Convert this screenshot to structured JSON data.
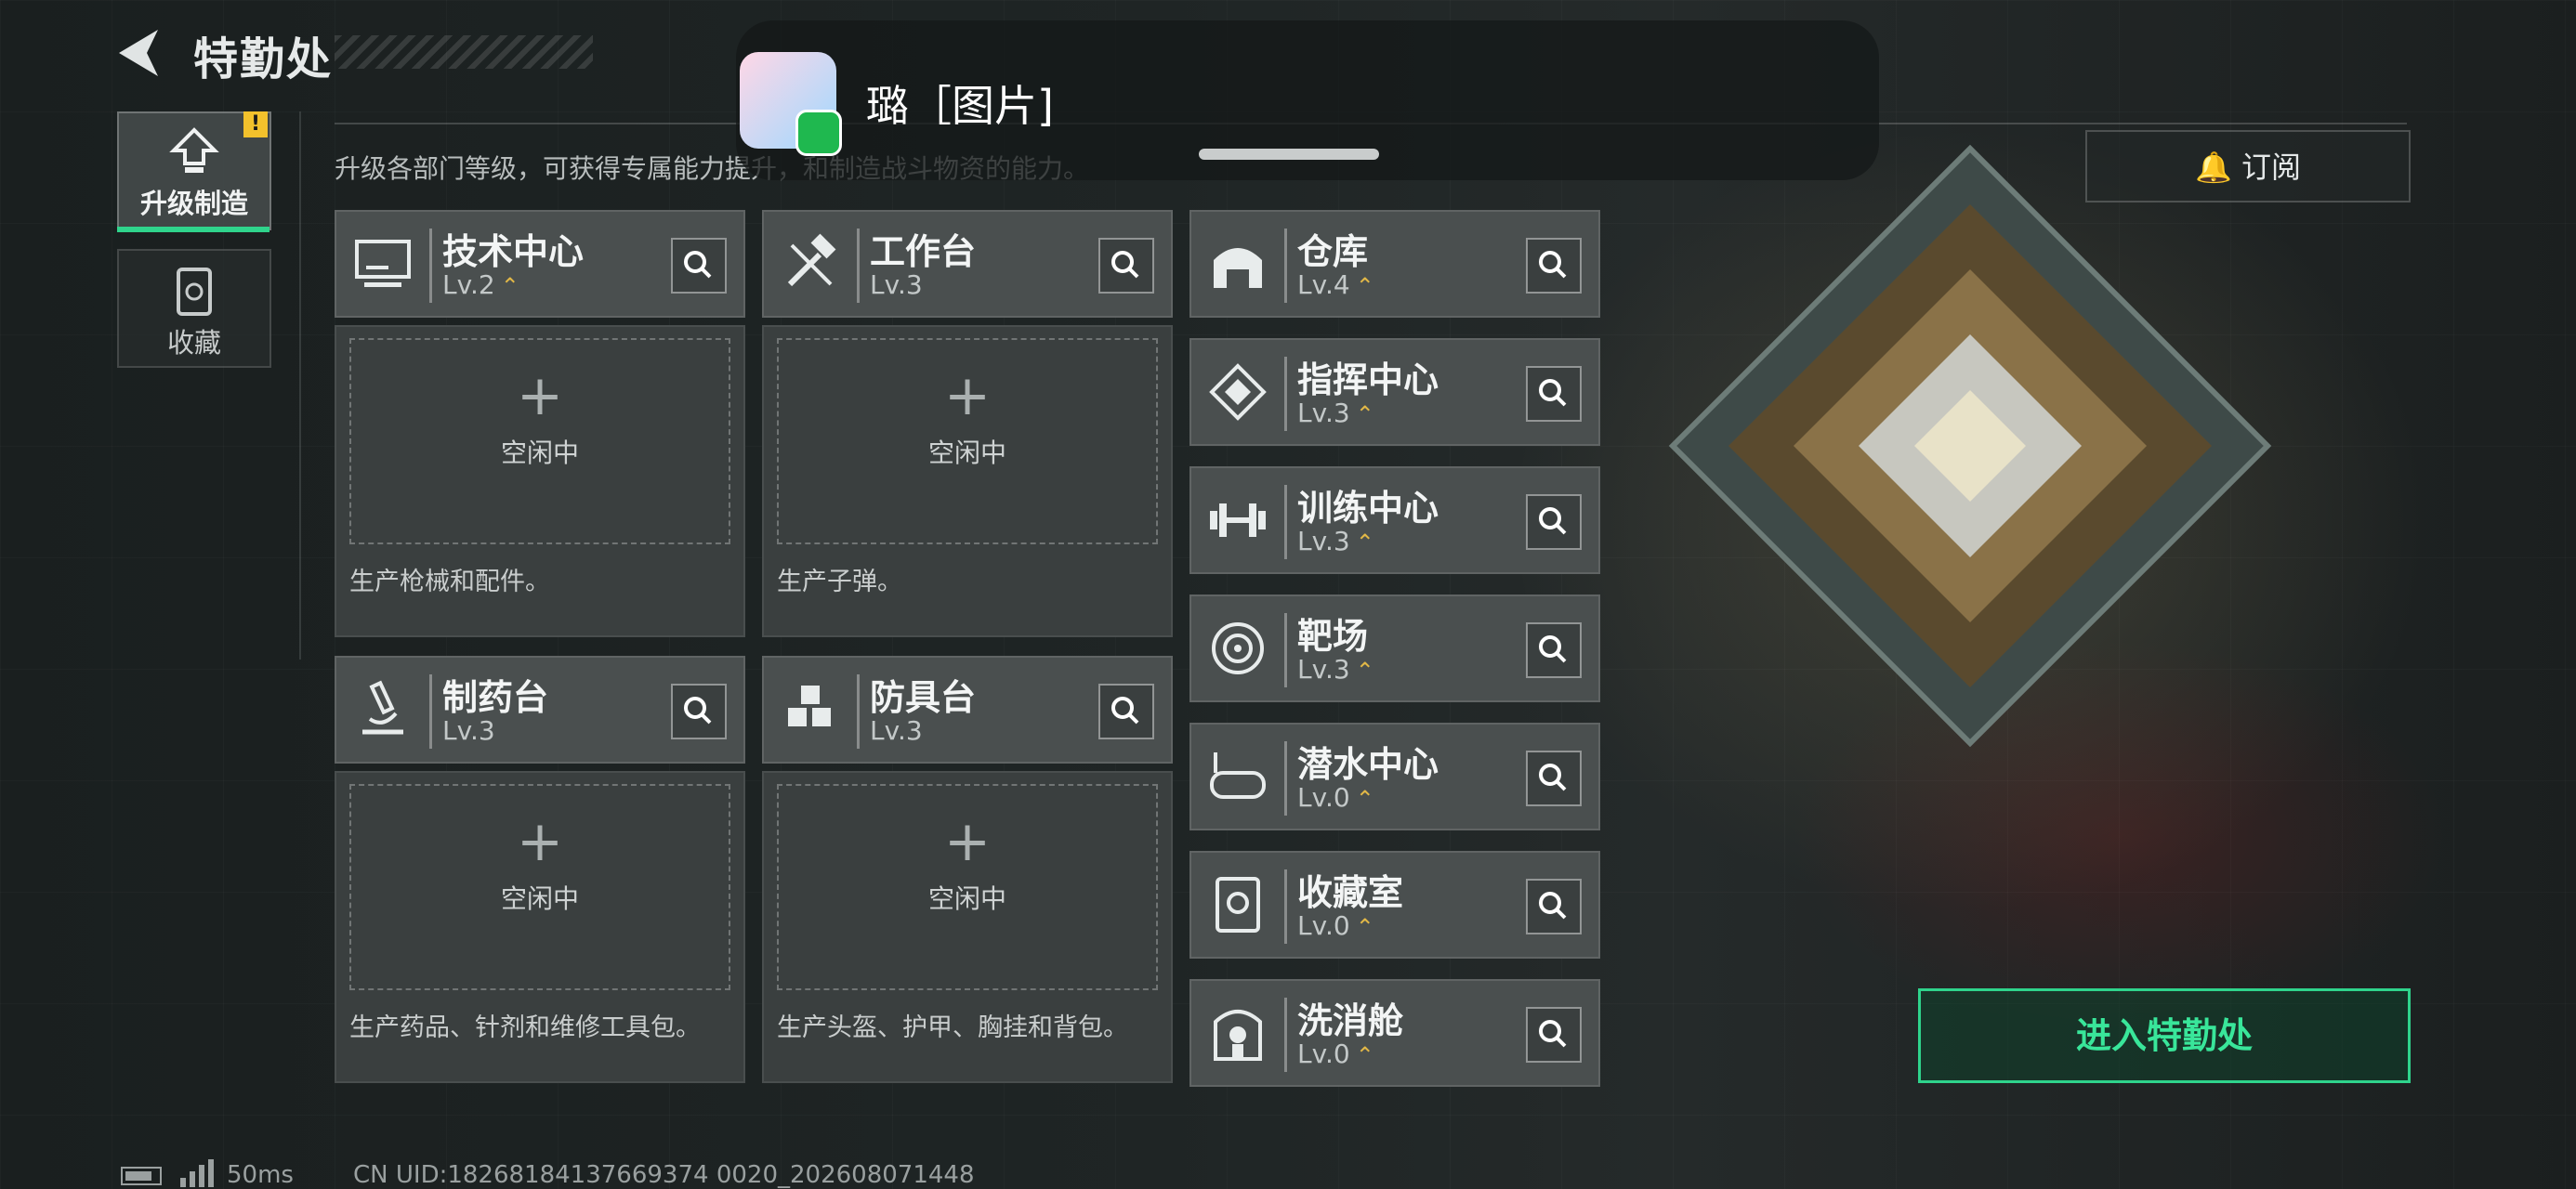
{
  "header": {
    "title": "特勤处",
    "subtitle": "升级各部门等级，可获得专属能力提升，和制造战斗物资的能力。"
  },
  "sidebar": {
    "items": [
      {
        "label": "升级制造",
        "icon": "upgrade-icon",
        "active": true,
        "badge": "!"
      },
      {
        "label": "收藏",
        "icon": "collection-icon",
        "active": false
      }
    ]
  },
  "production_cards": [
    {
      "name": "技术中心",
      "level": "Lv.2",
      "upgrade": "⌃",
      "status": "空闲中",
      "desc": "生产枪械和配件。",
      "icon": "monitor-icon"
    },
    {
      "name": "工作台",
      "level": "Lv.3",
      "upgrade": "",
      "status": "空闲中",
      "desc": "生产子弹。",
      "icon": "hammer-wrench-icon"
    },
    {
      "name": "制药台",
      "level": "Lv.3",
      "upgrade": "",
      "status": "空闲中",
      "desc": "生产药品、针剂和维修工具包。",
      "icon": "microscope-icon"
    },
    {
      "name": "防具台",
      "level": "Lv.3",
      "upgrade": "",
      "status": "空闲中",
      "desc": "生产头盔、护甲、胸挂和背包。",
      "icon": "cubes-icon"
    }
  ],
  "facilities": [
    {
      "name": "仓库",
      "level": "Lv.4",
      "upgrade": "⌃",
      "icon": "warehouse-icon"
    },
    {
      "name": "指挥中心",
      "level": "Lv.3",
      "upgrade": "⌃",
      "icon": "command-icon"
    },
    {
      "name": "训练中心",
      "level": "Lv.3",
      "upgrade": "⌃",
      "icon": "dumbbell-icon"
    },
    {
      "name": "靶场",
      "level": "Lv.3",
      "upgrade": "⌃",
      "icon": "target-icon"
    },
    {
      "name": "潜水中心",
      "level": "Lv.0",
      "upgrade": "⌃",
      "icon": "diving-mask-icon"
    },
    {
      "name": "收藏室",
      "level": "Lv.0",
      "upgrade": "⌃",
      "icon": "collection-room-icon"
    },
    {
      "name": "洗消舱",
      "level": "Lv.0",
      "upgrade": "⌃",
      "icon": "decon-icon"
    }
  ],
  "right_panel": {
    "subscribe_label": "订阅",
    "enter_label": "进入特勤处"
  },
  "notification": {
    "text": "璐［图片]"
  },
  "status_bar": {
    "ping": "50ms",
    "uid": "CN UID:18268184137669374 0020_202608071448"
  },
  "colors": {
    "accent_green": "#2fd48c",
    "upgrade_gold": "#e2b847",
    "warning_yellow": "#f2c12c"
  }
}
